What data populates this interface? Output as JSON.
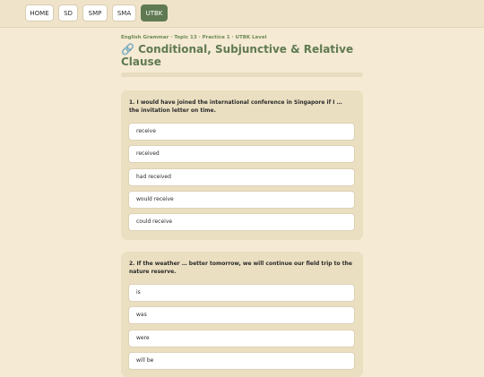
{
  "nav": {
    "items": [
      {
        "label": "HOME"
      },
      {
        "label": "SD"
      },
      {
        "label": "SMP"
      },
      {
        "label": "SMA"
      },
      {
        "label": "UTBK",
        "active": true
      }
    ]
  },
  "header": {
    "breadcrumb": "English Grammar · Topic 13 · Practice 1 · UTBK Level",
    "title_icon": "link-icon",
    "title": "🔗 Conditional, Subjunctive & Relative Clause"
  },
  "questions": [
    {
      "text": "1. I would have joined the international conference in Singapore if I … the invitation letter on time.",
      "options": [
        "receive",
        "received",
        "had received",
        "would receive",
        "could receive"
      ]
    },
    {
      "text": "2. If the weather … better tomorrow, we will continue our field trip to the nature reserve.",
      "options": [
        "is",
        "was",
        "were",
        "will be"
      ]
    }
  ],
  "colors": {
    "background": "#f5ead3",
    "accent": "#5f7a52",
    "card": "#ebdfc1"
  }
}
